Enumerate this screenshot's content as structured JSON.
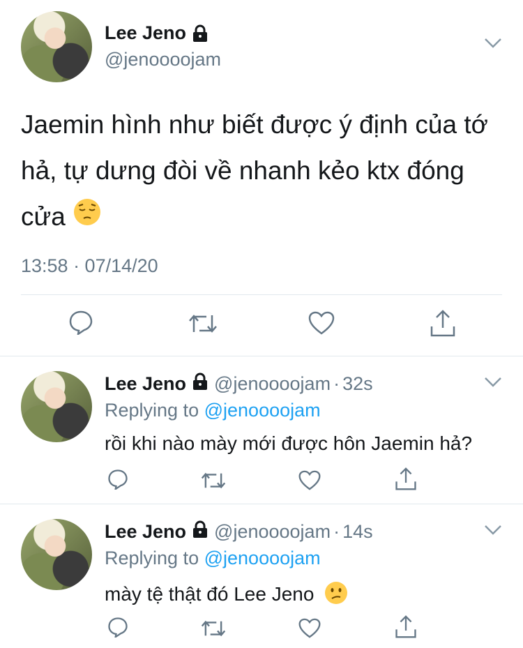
{
  "main_tweet": {
    "name": "Lee Jeno",
    "handle": "@jenoooojam",
    "text": "Jaemin hình như biết được ý định của tớ hả, tự dưng đòi về nhanh kẻo ktx đóng cửa",
    "emoji": "pensive-face",
    "timestamp": "13:58 · 07/14/20"
  },
  "replies": [
    {
      "name": "Lee Jeno",
      "handle": "@jenoooojam",
      "separator": "·",
      "time": "32s",
      "replying_prefix": "Replying to",
      "replying_mention": "@jenoooojam",
      "text": "rồi khi nào mày mới được hôn Jaemin hả?",
      "emoji": ""
    },
    {
      "name": "Lee Jeno",
      "handle": "@jenoooojam",
      "separator": "·",
      "time": "14s",
      "replying_prefix": "Replying to",
      "replying_mention": "@jenoooojam",
      "text": "mày tệ thật đó Lee Jeno",
      "emoji": "confused-face"
    }
  ],
  "icons": [
    "lock-icon",
    "chevron-down-icon",
    "reply-icon",
    "retweet-icon",
    "like-icon",
    "share-icon"
  ],
  "colors": {
    "link": "#1da1f2",
    "secondary_text": "#657786",
    "divider": "#e1e8ed"
  }
}
